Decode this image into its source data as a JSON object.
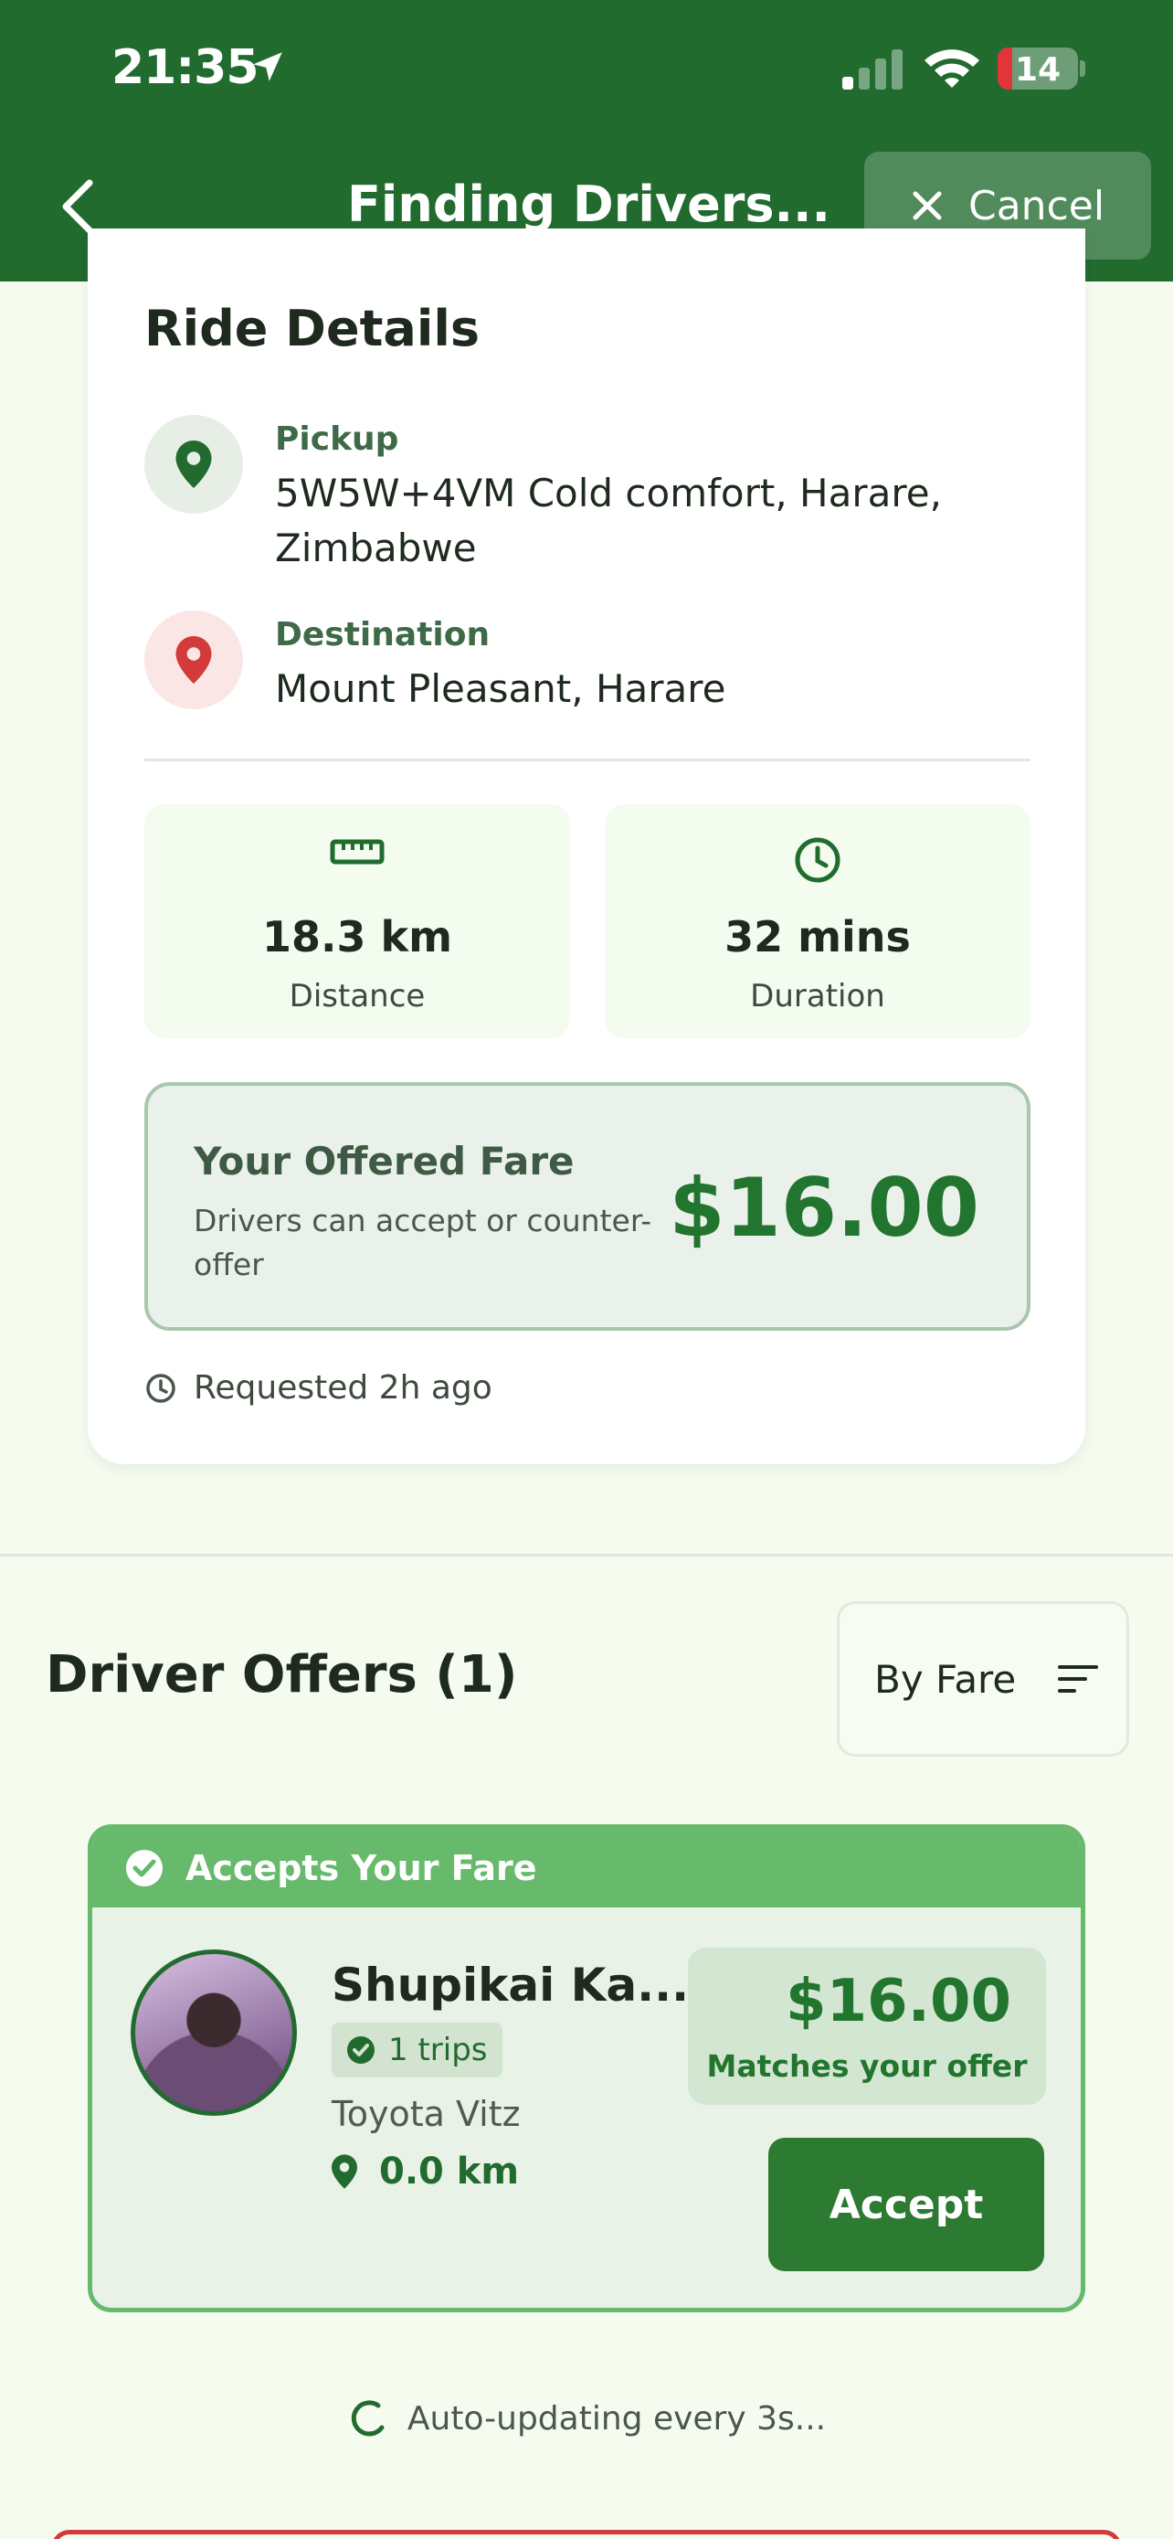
{
  "status_bar": {
    "time": "21:35",
    "battery": "14"
  },
  "header": {
    "title": "Finding Drivers...",
    "cancel_label": "Cancel"
  },
  "ride_details": {
    "title": "Ride Details",
    "pickup_label": "Pickup",
    "pickup_value": "5W5W+4VM Cold comfort, Harare, Zimbabwe",
    "destination_label": "Destination",
    "destination_value": "Mount Pleasant, Harare",
    "distance_value": "18.3 km",
    "distance_label": "Distance",
    "duration_value": "32 mins",
    "duration_label": "Duration",
    "fare_title": "Your Offered Fare",
    "fare_subtitle": "Drivers can accept or counter-offer",
    "fare_amount": "$16.00",
    "requested": "Requested 2h ago"
  },
  "offers": {
    "title": "Driver Offers (1)",
    "sort_label": "By Fare",
    "items": [
      {
        "banner": "Accepts Your Fare",
        "driver_name": "Shupikai Ka...",
        "trips": "1 trips",
        "car": "Toyota Vitz",
        "distance": "0.0 km",
        "price": "$16.00",
        "price_note": "Matches your offer",
        "accept_label": "Accept"
      }
    ]
  },
  "auto_update": "Auto-updating every 3s...",
  "colors": {
    "header": "#216b2f",
    "accent": "#22752f",
    "banner": "#67b96c",
    "danger": "#d33a3a"
  },
  "icons": [
    "location-arrow-icon",
    "signal-icon",
    "wifi-icon",
    "battery-icon",
    "back-chevron-icon",
    "close-icon",
    "pin-icon",
    "ruler-icon",
    "clock-icon",
    "sort-icon",
    "check-circle-icon",
    "spinner-icon"
  ]
}
